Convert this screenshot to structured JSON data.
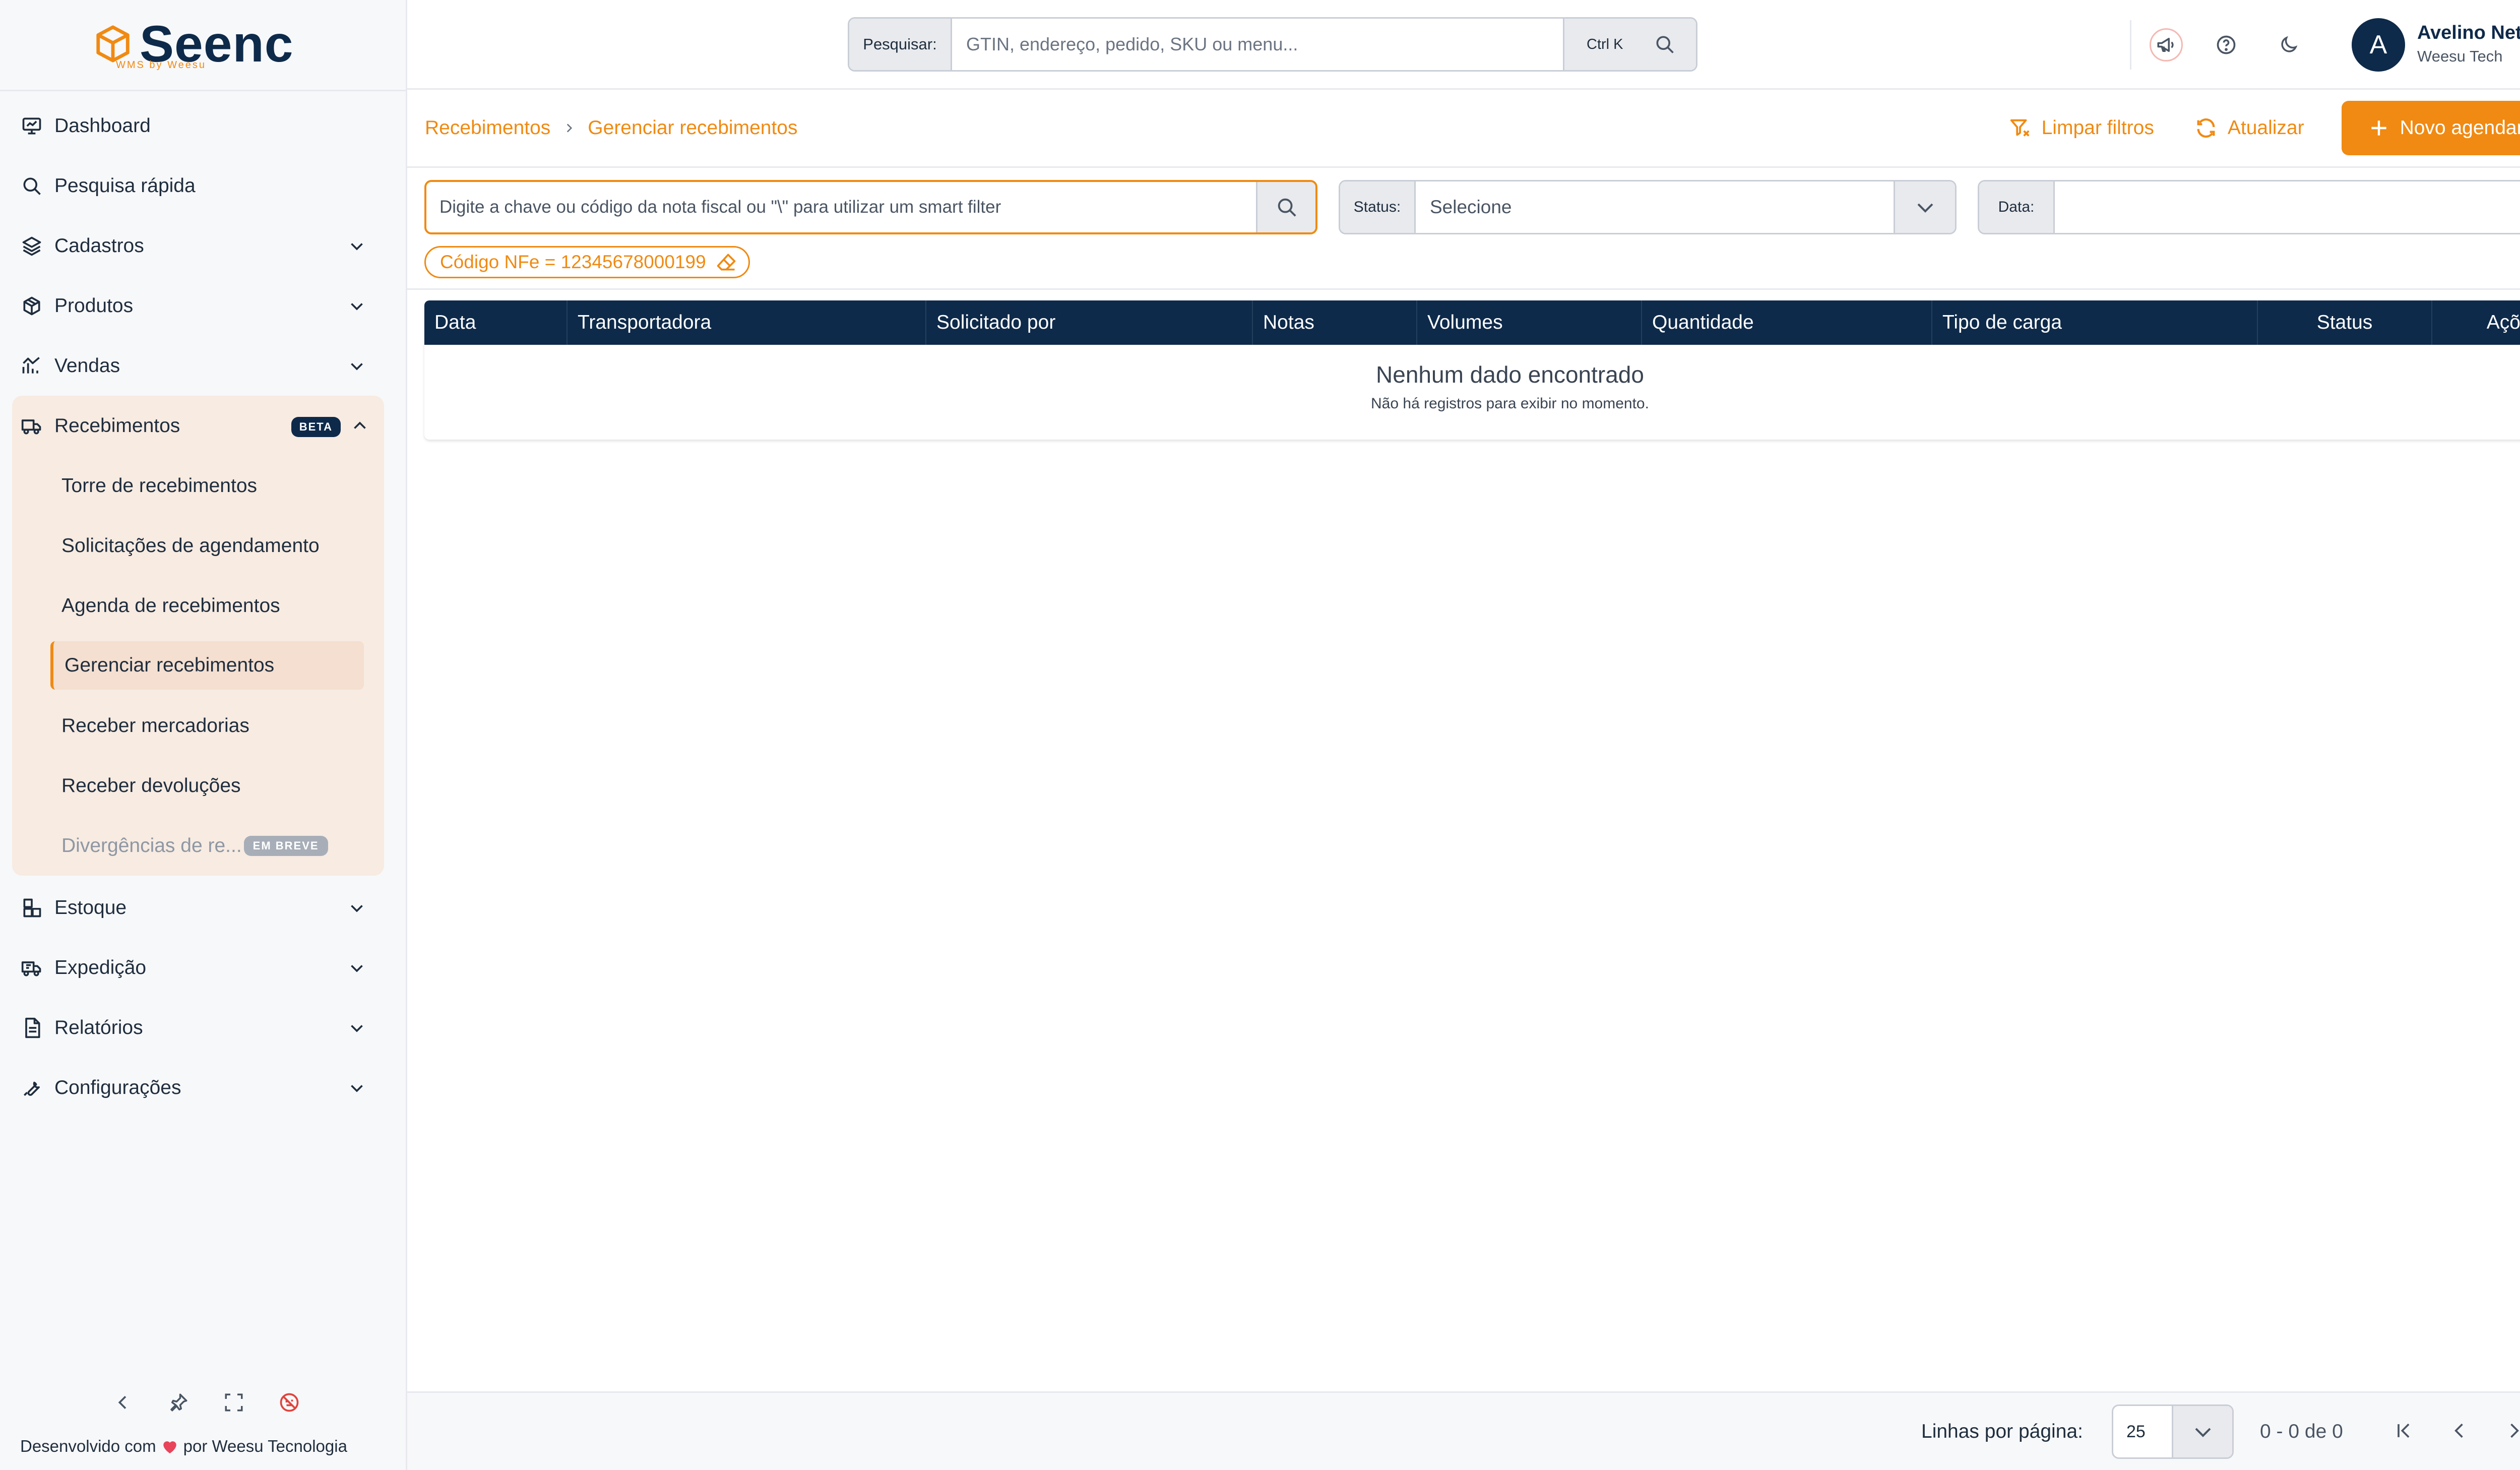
{
  "brand": {
    "name": "Seenc",
    "tagline": "WMS by Weesu",
    "accent": "#f08a12",
    "navy": "#0e2a4a"
  },
  "search": {
    "label": "Pesquisar:",
    "placeholder": "GTIN, endereço, pedido, SKU ou menu...",
    "shortcut": "Ctrl K"
  },
  "user": {
    "initial": "A",
    "name": "Avelino Neto",
    "org": "Weesu Tech"
  },
  "sidebar": {
    "items": [
      {
        "label": "Dashboard",
        "icon": "monitor-icon"
      },
      {
        "label": "Pesquisa rápida",
        "icon": "search-icon"
      },
      {
        "label": "Cadastros",
        "icon": "layers-icon"
      },
      {
        "label": "Produtos",
        "icon": "box-icon"
      },
      {
        "label": "Vendas",
        "icon": "chart-icon"
      }
    ],
    "group": {
      "label": "Recebimentos",
      "badge": "BETA",
      "icon": "truck-icon",
      "sub": [
        {
          "label": "Torre de recebimentos"
        },
        {
          "label": "Solicitações de agendamento"
        },
        {
          "label": "Agenda de recebimentos"
        },
        {
          "label": "Gerenciar recebimentos",
          "active": true
        },
        {
          "label": "Receber mercadorias"
        },
        {
          "label": "Receber devoluções"
        },
        {
          "label": "Divergências de re...",
          "badge": "EM BREVE",
          "disabled": true
        }
      ]
    },
    "items_after": [
      {
        "label": "Estoque",
        "icon": "stock-icon"
      },
      {
        "label": "Expedição",
        "icon": "shipping-icon"
      },
      {
        "label": "Relatórios",
        "icon": "report-icon"
      },
      {
        "label": "Configurações",
        "icon": "wrench-icon"
      }
    ],
    "footer": {
      "before": "Desenvolvido com",
      "after": "por Weesu Tecnologia"
    }
  },
  "breadcrumb": {
    "root": "Recebimentos",
    "current": "Gerenciar recebimentos"
  },
  "actions": {
    "clear_filters": "Limpar filtros",
    "refresh": "Atualizar",
    "new_schedule": "Novo agendamento"
  },
  "filters": {
    "smart_placeholder": "Digite a chave ou código da nota fiscal ou  \"\\\" para utilizar um smart filter",
    "status_label": "Status:",
    "status_value": "Selecione",
    "date_label": "Data:",
    "date_value": "",
    "chip": "Código NFe = 12345678000199"
  },
  "table": {
    "columns": [
      "Data",
      "Transportadora",
      "Solicitado por",
      "Notas",
      "Volumes",
      "Quantidade",
      "Tipo de carga",
      "Status",
      "Ações"
    ],
    "empty_title": "Nenhum dado encontrado",
    "empty_subtitle": "Não há registros para exibir no momento."
  },
  "pagination": {
    "rows_label": "Linhas por página:",
    "rows_value": "25",
    "range": "0 - 0 de 0"
  }
}
